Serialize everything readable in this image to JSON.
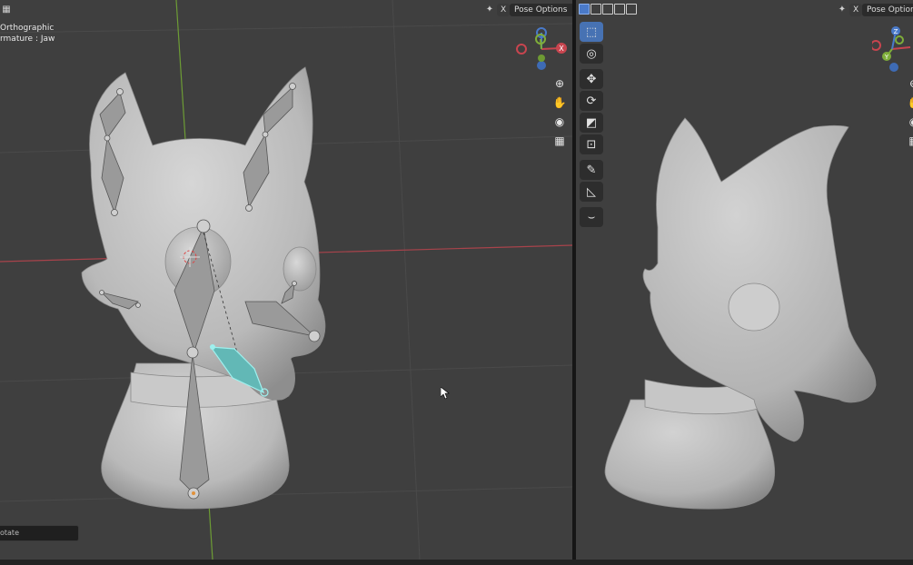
{
  "left_viewport": {
    "header": {
      "pose_options_label": "Pose Options",
      "close_label": "X",
      "chevron": "⌄"
    },
    "overlay": {
      "view_mode": "Orthographic",
      "active_object": "rmature : Jaw"
    },
    "status_field": "otate",
    "nav_icons": [
      "zoom-icon",
      "hand-pan-icon",
      "camera-icon",
      "grid-icon"
    ],
    "gizmo": {
      "x_label": "X",
      "y_label": "Y",
      "z_label": "Z"
    }
  },
  "right_viewport": {
    "header": {
      "pose_options_label": "Pose Options",
      "close_label": "X"
    },
    "tools": [
      "select-box-icon",
      "cursor-icon",
      "move-icon",
      "rotate-icon",
      "scale-icon",
      "transform-icon",
      "annotate-icon",
      "measure-icon",
      "bone-bend-icon"
    ],
    "gizmo": {
      "x_label": "X",
      "y_label": "Y",
      "z_label": "Z"
    }
  },
  "colors": {
    "viewport_bg": "#3f3f3f",
    "axis_x": "#c8454f",
    "axis_y": "#7fae3a",
    "axis_z": "#4a7ac9",
    "active_bone": "#5fc7c4",
    "model": "#c4c4c4"
  }
}
